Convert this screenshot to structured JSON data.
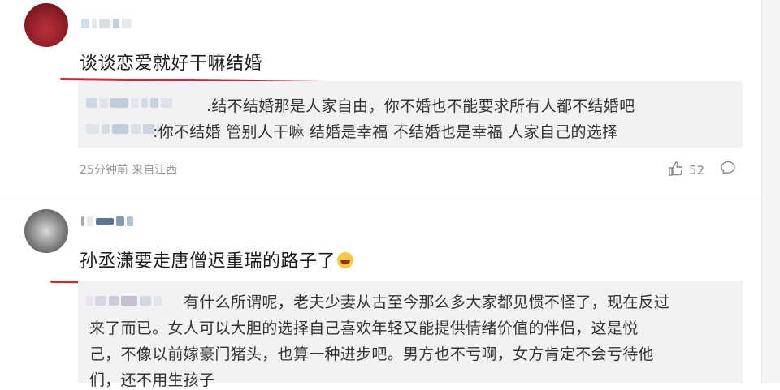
{
  "comments": [
    {
      "text": "谈谈恋爱就好干嘛结婚",
      "replies": [
        ".结不结婚那是人家自由，你不婚也不能要求所有人都不结婚吧",
        ":你不结婚 管别人干嘛 结婚是幸福 不结婚也是幸福 人家自己的选择"
      ],
      "time_location": "25分钟前 来自江西",
      "likes": "52",
      "like_icon": "thumbs-up-icon",
      "reply_icon": "comment-bubble-icon"
    },
    {
      "text": "孙丞潇要走唐僧迟重瑞的路子了",
      "emoji": "laughing-emoji-icon",
      "replies": [
        "有什么所谓呢，老夫少妻从古至今那么多大家都见惯不怪了，现在反过",
        "来了而已。女人可以大胆的选择自己喜欢年轻又能提供情绪价值的伴侣，这是悦",
        "己，不像以前嫁豪门猪头，也算一种进步吧。男方也不亏啊，女方肯定不会亏待他",
        "们，还不用生孩子"
      ]
    }
  ],
  "colors": {
    "underline": "#d6263a",
    "reply_bg": "#f2f2f4",
    "meta": "#999999"
  }
}
